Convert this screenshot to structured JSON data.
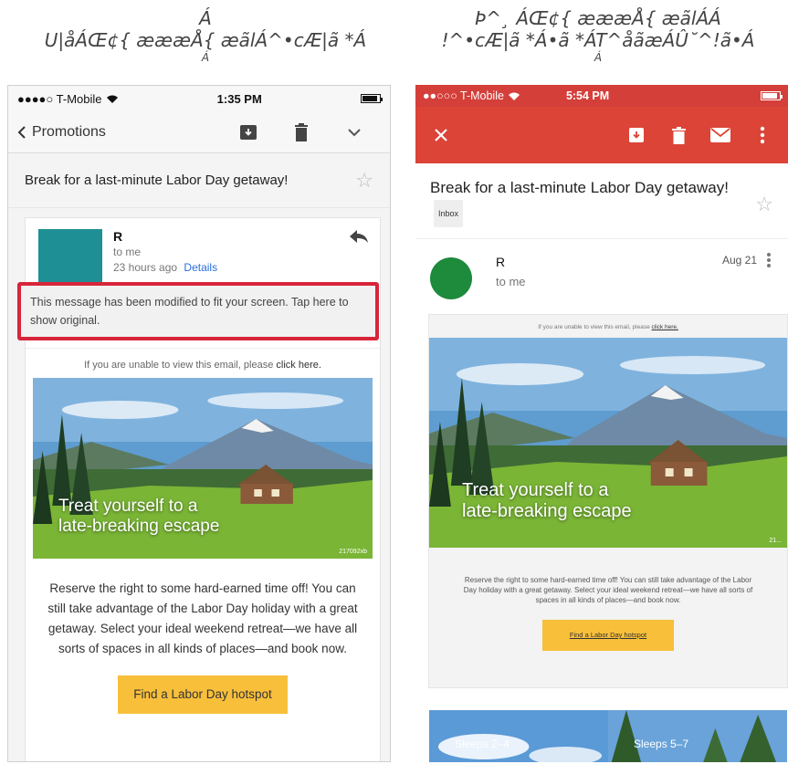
{
  "captions": {
    "left": "Á",
    "left_line2": "U|åÁŒ¢{ æææÅ{ æãlÁ^•cÆ|ã *Á",
    "left_line3": "Á",
    "right": "Þ^¸ ÁŒ¢{ æææÅ{ æãlÁÁ",
    "right_line2": "!^•cÆ|ã *Á•ã *ÁT^åãæÁÛ˘^!ã•Á",
    "right_line3": "Á"
  },
  "ios": {
    "status": {
      "carrier": "●●●●○ T-Mobile",
      "time": "1:35 PM"
    },
    "nav": {
      "back_label": "Promotions"
    },
    "subject": "Break for a last-minute Labor Day getaway!",
    "sender": {
      "name": "R",
      "to": "to me",
      "time": "23 hours ago",
      "details": "Details"
    },
    "modified_notice": "This message has been modified to fit your screen. Tap here to show original.",
    "email": {
      "unable_prefix": "If you are unable to view this email, please ",
      "unable_link": "click here.",
      "hero_line1": "Treat yourself to a",
      "hero_line2": "late-breaking escape",
      "hero_tag": "217092xb",
      "body": "Reserve the right to some hard-earned time off! You can still take advantage of the Labor Day holiday with a great getaway. Select your ideal weekend retreat—we have all sorts of spaces in all kinds of places—and book now.",
      "cta": "Find a Labor Day hotspot"
    }
  },
  "android": {
    "status": {
      "carrier": "●●○○○ T-Mobile",
      "time": "5:54 PM"
    },
    "subject": "Break for a last-minute Labor Day getaway!",
    "inbox_chip": "Inbox",
    "sender": {
      "name": "R",
      "to": "to me",
      "date": "Aug 21"
    },
    "email": {
      "unable_prefix": "If you are unable to view this email, please ",
      "unable_link": "click here.",
      "hero_line1": "Treat yourself to a",
      "hero_line2": "late-breaking escape",
      "hero_tag": "21...",
      "body": "Reserve the right to some hard-earned time off! You can still take advantage of the Labor Day holiday with a great getaway. Select your ideal weekend retreat—we have all sorts of spaces in all kinds of places—and book now.",
      "cta": "Find a Labor Day hotspot",
      "tiles": [
        "Sleeps 2–4",
        "Sleeps 5–7"
      ]
    }
  },
  "colors": {
    "highlight_red": "#d7253a",
    "gmail_red": "#db4437",
    "cta_yellow": "#f8bf3b",
    "ios_avatar": "#1e8f95",
    "android_avatar": "#1d8a3c"
  },
  "icons": {
    "ios_nav": [
      "chevron-left-icon",
      "archive-icon",
      "trash-icon",
      "chevron-down-icon"
    ],
    "android_bar": [
      "close-icon",
      "archive-icon",
      "trash-icon",
      "mail-icon",
      "more-vert-icon"
    ]
  }
}
